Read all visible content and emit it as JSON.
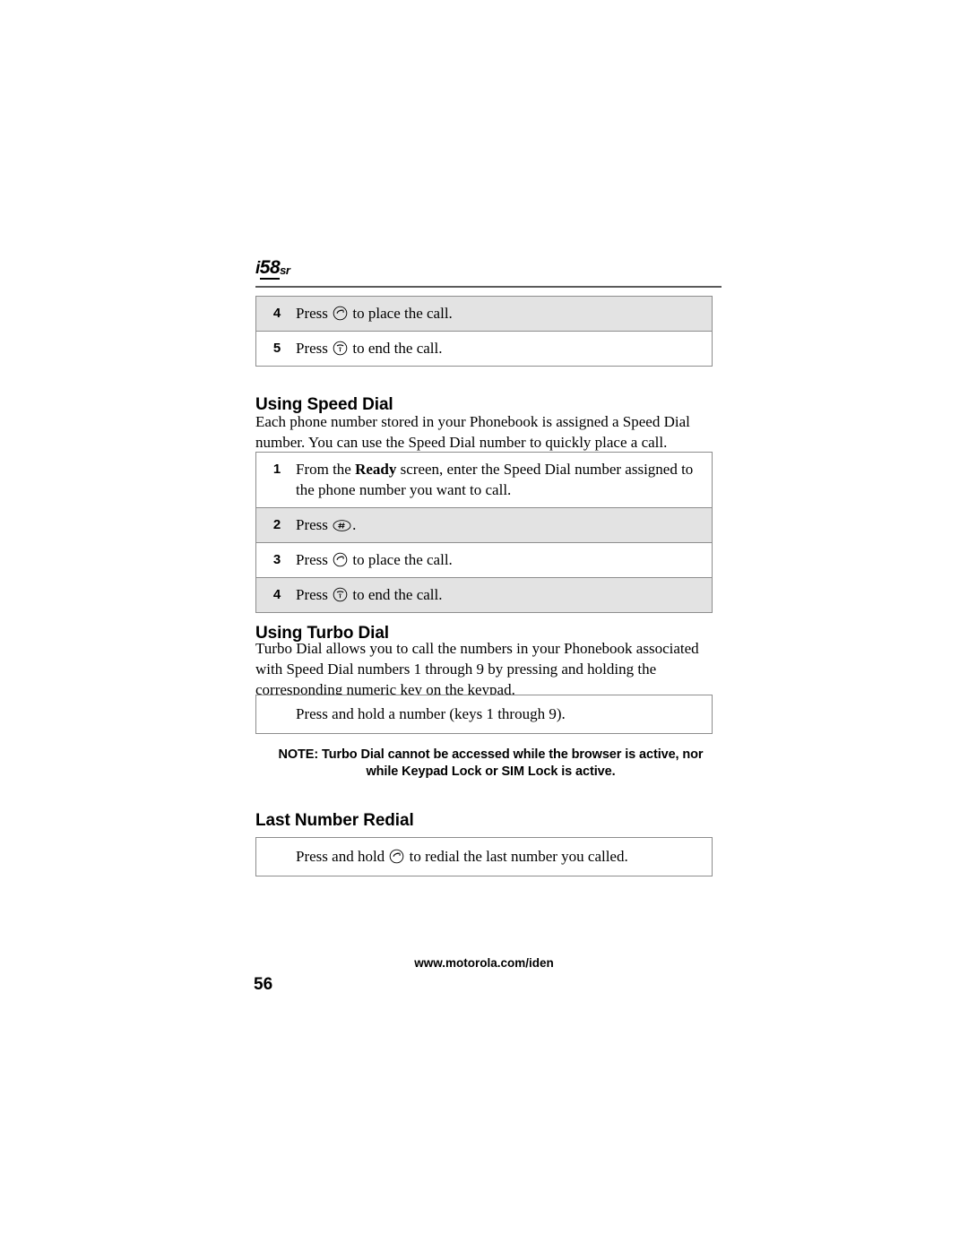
{
  "header": {
    "product_mark_i": "i",
    "product_mark_number": "58",
    "product_mark_suffix": "sr"
  },
  "top_steps": {
    "rows": [
      {
        "num": "4",
        "text_before": "Press ",
        "icon": "send-key-icon",
        "text_after": " to place the call."
      },
      {
        "num": "5",
        "text_before": "Press ",
        "icon": "end-key-icon",
        "text_after": " to end the call."
      }
    ]
  },
  "section_speed_dial": {
    "heading": "Using Speed Dial",
    "paragraph": "Each phone number stored in your Phonebook is assigned a Speed Dial number. You can use the Speed Dial number to quickly place a call.",
    "steps": [
      {
        "num": "1",
        "text_before": "From the ",
        "bold": "Ready",
        "text_after": " screen, enter the Speed Dial number assigned to the phone number you want to call."
      },
      {
        "num": "2",
        "text_before": "Press ",
        "icon": "pound-key-icon",
        "text_after": "."
      },
      {
        "num": "3",
        "text_before": "Press ",
        "icon": "send-key-icon",
        "text_after": " to place the call."
      },
      {
        "num": "4",
        "text_before": "Press ",
        "icon": "end-key-icon",
        "text_after": " to end the call."
      }
    ]
  },
  "section_turbo_dial": {
    "heading": "Using Turbo Dial",
    "paragraph": "Turbo Dial allows you to call the numbers in your Phonebook associated with Speed Dial numbers 1 through 9 by pressing and holding the corresponding numeric key on the keypad.",
    "instruction": "Press and hold a number (keys 1 through 9).",
    "note_line1": "NOTE: Turbo Dial cannot be accessed while the browser is active, nor",
    "note_line2": "while Keypad Lock or SIM Lock is active."
  },
  "section_last_number_redial": {
    "heading": "Last Number Redial",
    "instruction_before": "Press and hold ",
    "instruction_icon": "send-key-icon",
    "instruction_after": " to redial the last number you called."
  },
  "footer": {
    "url": "www.motorola.com/iden",
    "page_number": "56"
  },
  "colors": {
    "shade_row": "#e3e3e3",
    "rule": "#5a5a5a",
    "border": "#8d8d8d",
    "text": "#000000"
  }
}
